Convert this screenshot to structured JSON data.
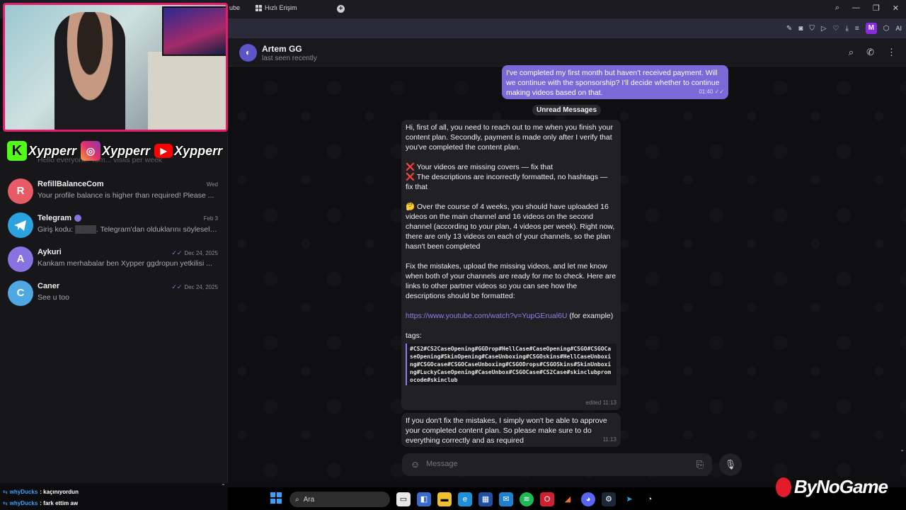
{
  "browser": {
    "tabs": [
      {
        "label": "ube"
      },
      {
        "label": "Hızlı Erişim"
      }
    ],
    "newtab": "+",
    "window_controls": [
      "⌕",
      "—",
      "❐",
      "✕"
    ],
    "toolbar_avatar": "M",
    "toolbar_ai": "AI"
  },
  "overlay": {
    "kick_handle": "Xypperr",
    "instagram_handle": "Xypperr",
    "youtube_handle": "Xypperr",
    "watermark": "ByNoGame"
  },
  "sidebar": {
    "partial_preview": "Hello everyone! Tom... visits per week",
    "chats": [
      {
        "name": "RefillBalanceCom",
        "avatar_letter": "R",
        "avatar_color": "#e65b66",
        "preview": "Your profile balance is higher than required! Please ...",
        "date": "Wed",
        "verified": false,
        "read": false
      },
      {
        "name": "Telegram",
        "avatar_letter": "",
        "avatar_color": "#2aa3df",
        "preview": "Giriş kodu: ▒▒▒▒. Telegram'dan olduklarını söyleseler...",
        "date": "Feb 3",
        "verified": true,
        "read": false
      },
      {
        "name": "Aykuri",
        "avatar_letter": "A",
        "avatar_color": "#8774e1",
        "preview": "Kankam merhabalar ben Xypper ggdropun yetkilisi ...",
        "date": "Dec 24, 2025",
        "verified": false,
        "read": true
      },
      {
        "name": "Caner",
        "avatar_letter": "C",
        "avatar_color": "#4fa8e2",
        "preview": "See u too",
        "date": "Dec 24, 2025",
        "verified": false,
        "read": true
      }
    ]
  },
  "stream_chat": [
    {
      "user": "whyDucks",
      "message": ": kaçınıyordun"
    },
    {
      "user": "whyDucks",
      "message": ": fark ettim aw"
    }
  ],
  "chat": {
    "contact_name": "Artem GG",
    "contact_status": "last seen recently",
    "unread_label": "Unread Messages",
    "outgoing": {
      "text": "I've completed my first month but haven't received payment. Will we continue with the sponsorship? I'll decide whether to continue making videos based on that.",
      "time": "01:40"
    },
    "incoming_main": {
      "p1": "Hi, first of all, you need to reach out to me when you finish your content plan. Secondly, payment is made only after I verify that you've completed the content plan.",
      "p2a": "❌ Your videos are missing covers — fix that",
      "p2b": "❌ The descriptions are incorrectly formatted, no hashtags — fix that",
      "p3": "🤔 Over the course of 4 weeks, you should have uploaded 16 videos on the main channel and 16 videos on the second channel (according to your plan, 4 videos per week). Right now, there are only 13 videos on each of your channels, so the plan hasn't been completed",
      "p4": "Fix the mistakes, upload the missing videos, and let me know when both of your channels are ready for me to check. Here are links to other partner videos so you can see how the descriptions should be formatted:",
      "link": "https://www.youtube.com/watch?v=YupGErual6U",
      "link_suffix": " (for example)",
      "tags_label": "tags:",
      "tags": "#CS2#CS2CaseOpening#GGDrop#HellCase#CaseOpening#CSGO#CSGOCaseOpening#SkinOpening#CaseUnboxing#CSGOskins#HellCaseUnboxing#CSGOcase#CSGOCaseUnboxing#CSGODrops#CSGOSkins#SkinUnboxing#LuckyCaseOpening#CaseUnbox#CSGOCase#CS2Case#skinclubpromocode#skinclub",
      "time": "edited 11:13"
    },
    "incoming_second": {
      "text": "If you don't fix the mistakes, I simply won't be able to approve your completed content plan. So please make sure to do everything correctly and as required",
      "time": "11:13"
    },
    "composer_placeholder": "Message"
  },
  "taskbar": {
    "search_placeholder": "Ara"
  }
}
